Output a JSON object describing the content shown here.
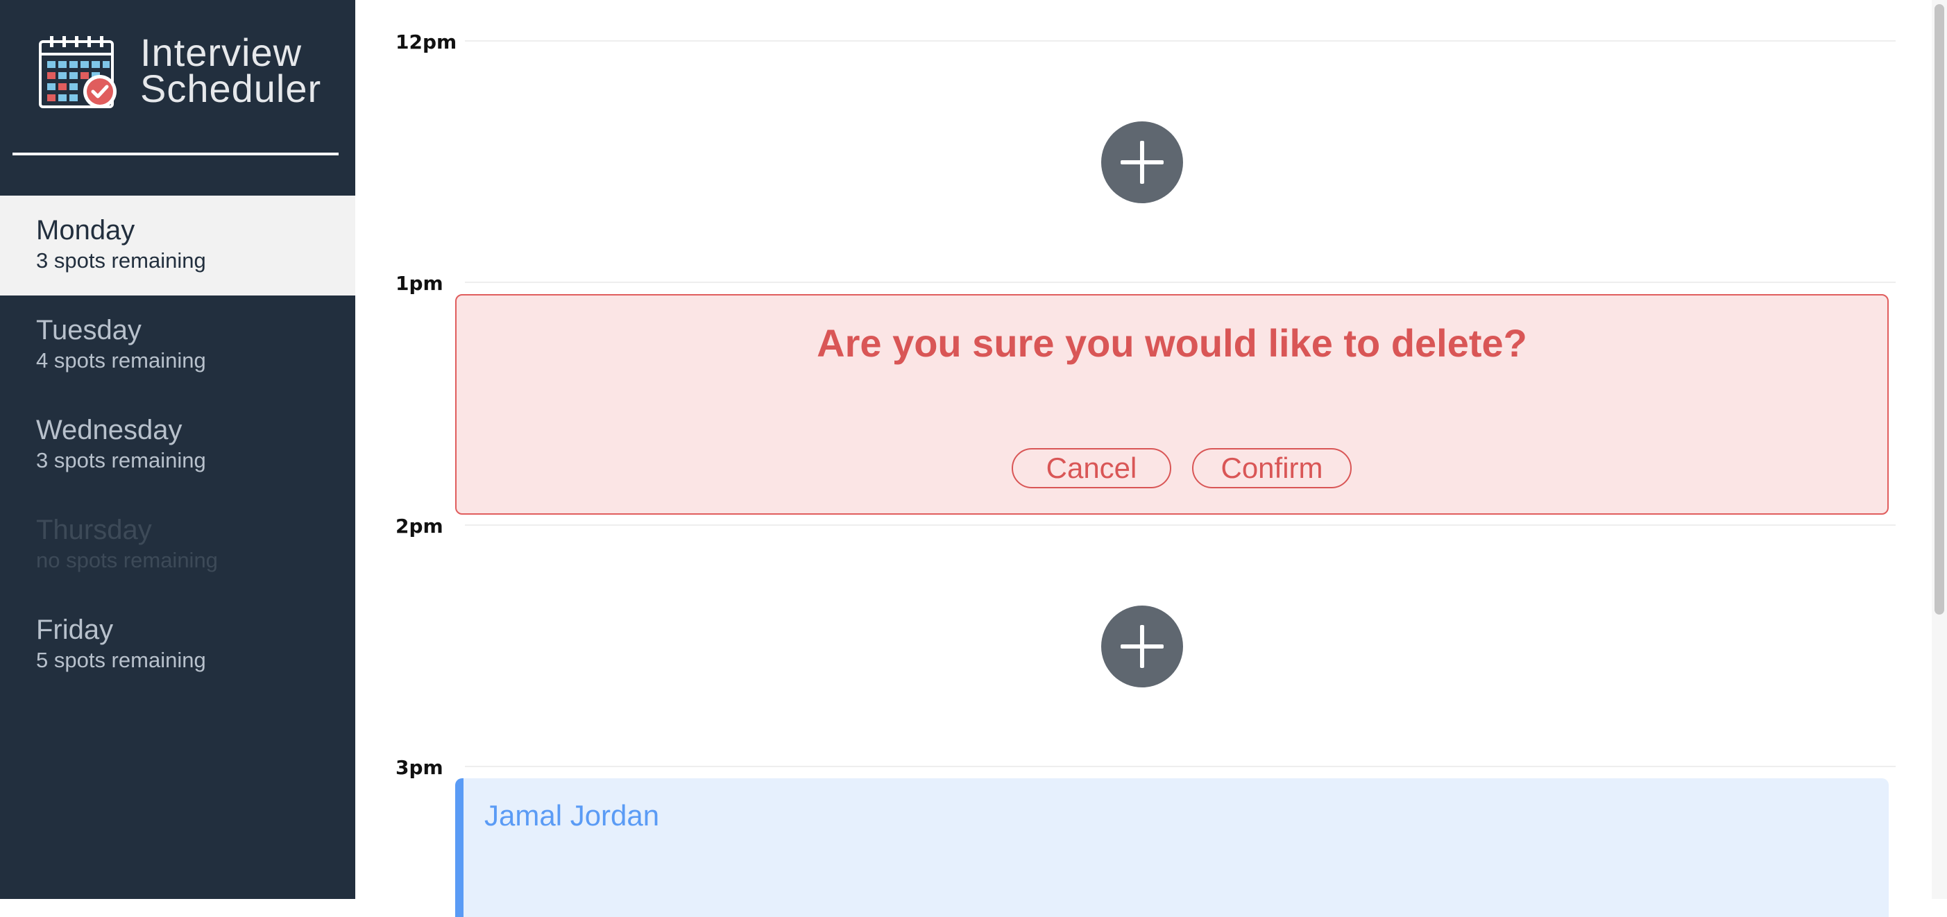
{
  "app": {
    "title_line1": "Interview",
    "title_line2": "Scheduler",
    "logo_icon": "calendar-check-icon"
  },
  "days": [
    {
      "name": "Monday",
      "spots": "3 spots remaining",
      "selected": true
    },
    {
      "name": "Tuesday",
      "spots": "4 spots remaining",
      "selected": false
    },
    {
      "name": "Wednesday",
      "spots": "3 spots remaining",
      "selected": false
    },
    {
      "name": "Thursday",
      "spots": "no spots remaining",
      "selected": false
    },
    {
      "name": "Friday",
      "spots": "5 spots remaining",
      "selected": false
    }
  ],
  "slots": [
    {
      "time": "12pm",
      "state": "empty"
    },
    {
      "time": "1pm",
      "state": "confirm-delete"
    },
    {
      "time": "2pm",
      "state": "empty"
    },
    {
      "time": "3pm",
      "state": "booked"
    }
  ],
  "confirm": {
    "message": "Are you sure you would like to delete?",
    "cancel_label": "Cancel",
    "confirm_label": "Confirm"
  },
  "appointment": {
    "student": "Jamal Jordan"
  },
  "colors": {
    "sidebar_bg": "#222f3e",
    "selected_day_bg": "#f2f2f2",
    "danger": "#d95656",
    "danger_bg": "#fbe5e5",
    "booked_accent": "#5a9bf5",
    "booked_bg": "#e6f0fd",
    "add_button": "#5f6770"
  }
}
